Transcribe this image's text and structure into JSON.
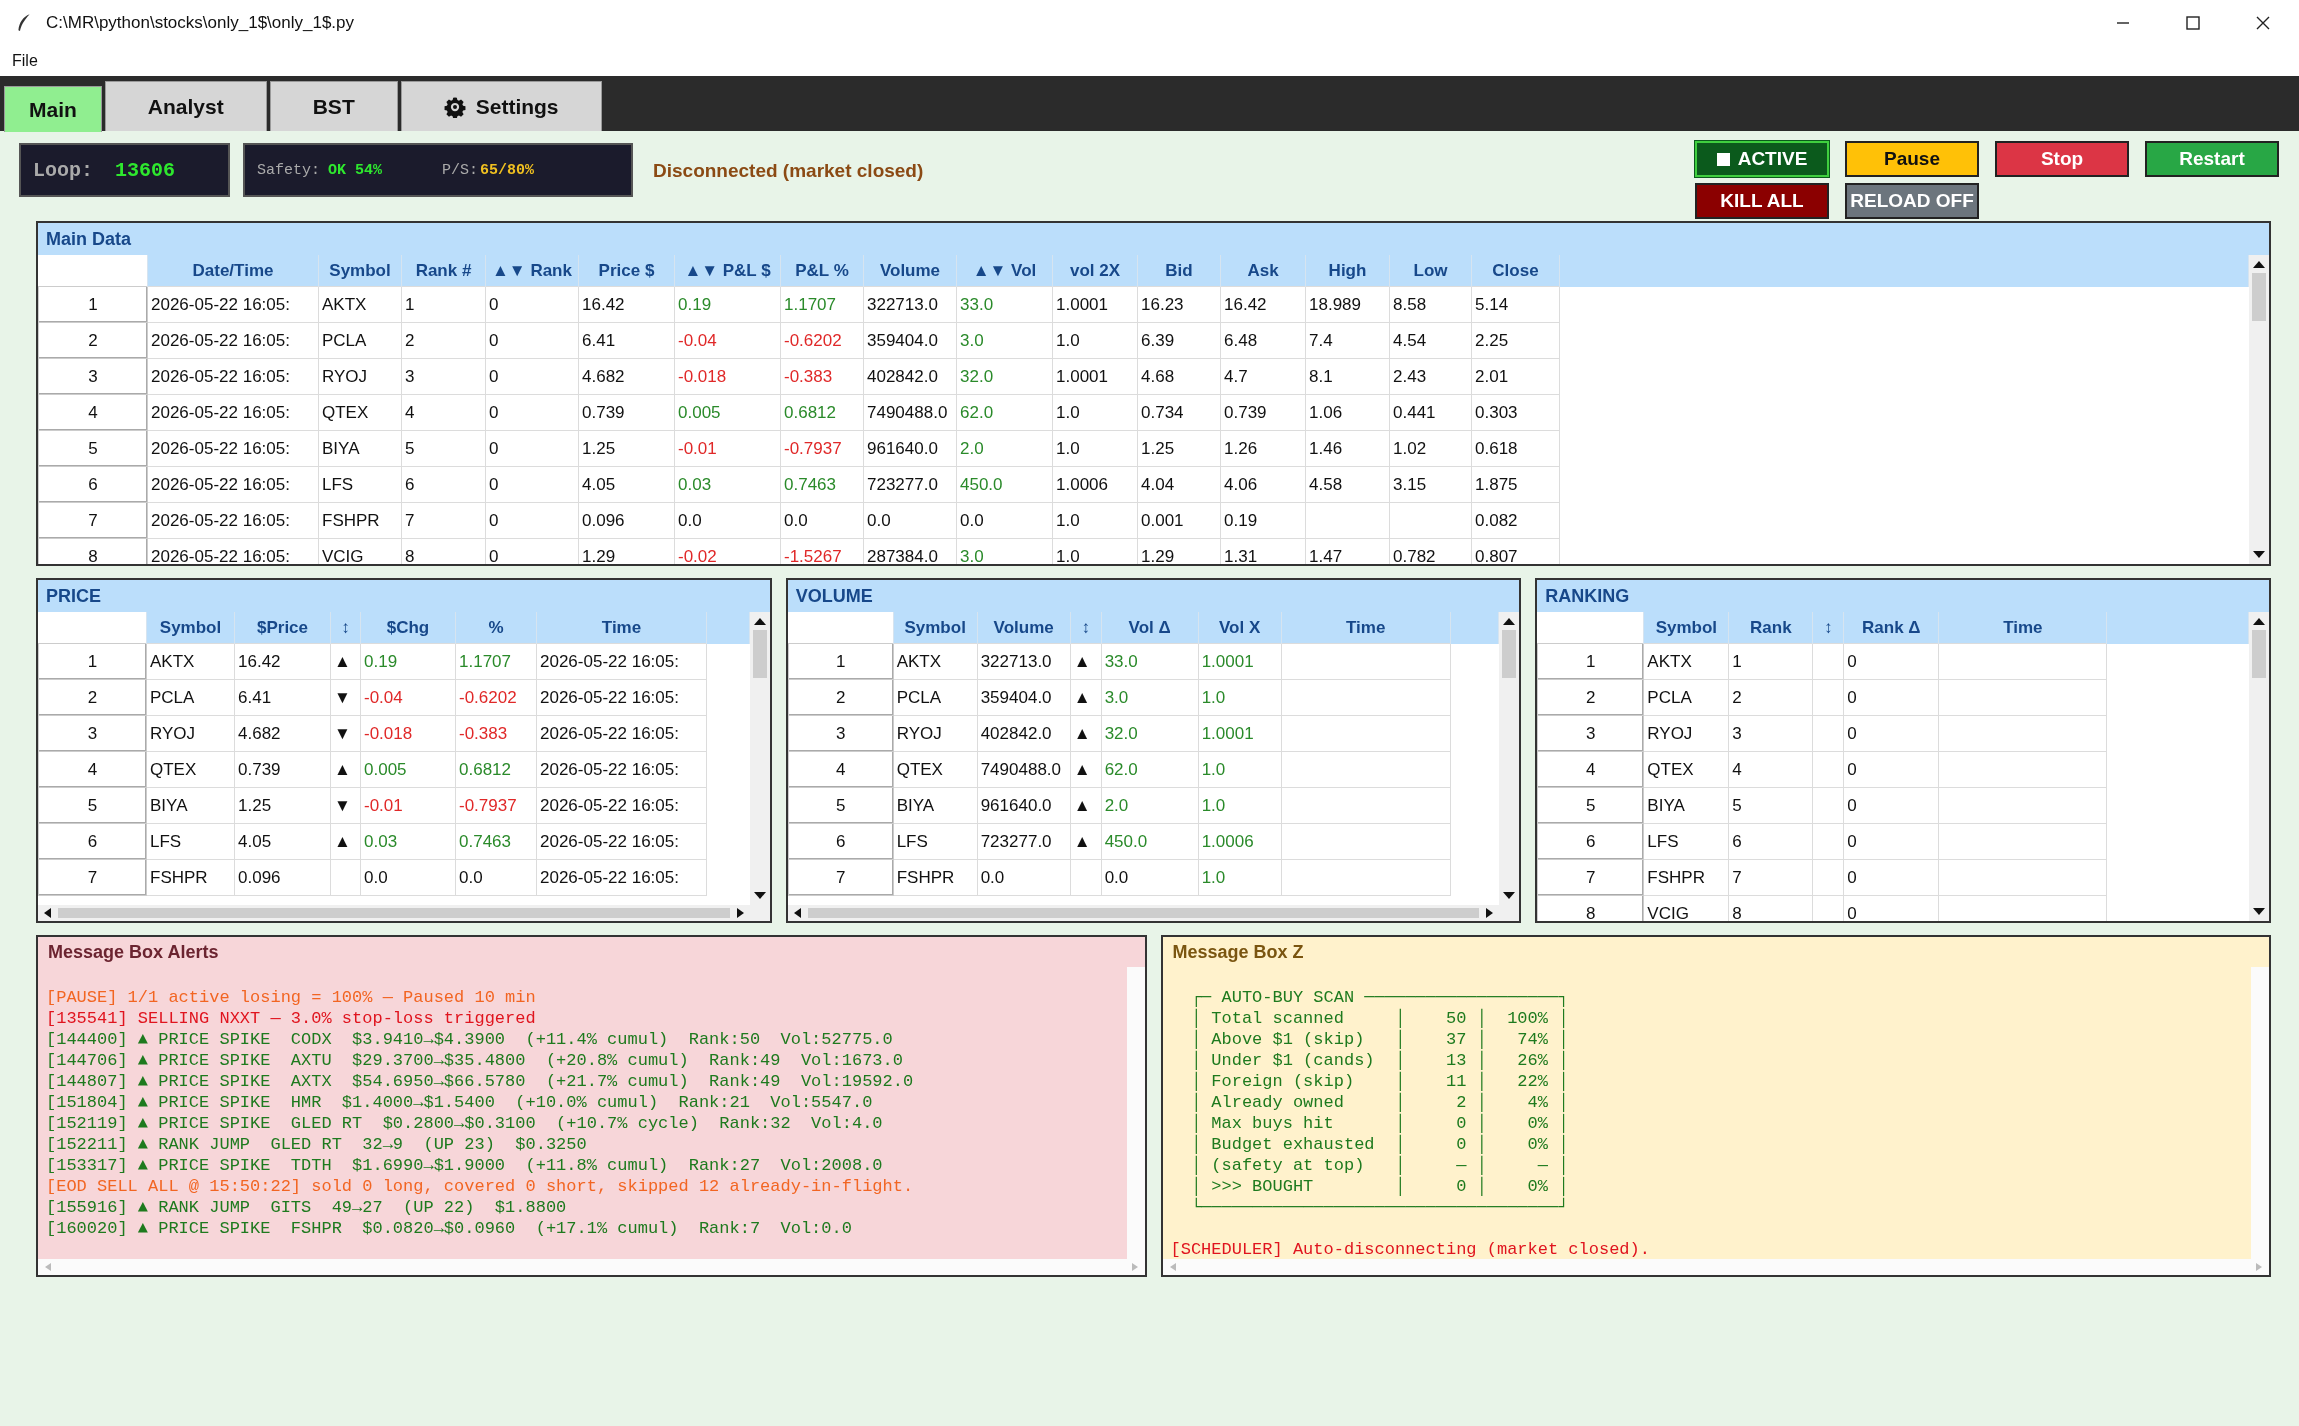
{
  "window": {
    "title": "C:\\MR\\python\\stocks\\only_1$\\only_1$.py"
  },
  "menu": [
    "File"
  ],
  "tabs": [
    {
      "label": "Main",
      "selected": true,
      "kind": "plain"
    },
    {
      "label": "Analyst",
      "selected": false,
      "kind": "plain"
    },
    {
      "label": "BST",
      "selected": false,
      "kind": "plain"
    },
    {
      "label": "Settings",
      "selected": false,
      "kind": "gear"
    }
  ],
  "status": {
    "loop_label": "Loop:",
    "loop_value": "13606",
    "safety_label": "Safety:",
    "safety_value": "OK 54%",
    "ps_label": "P/S:",
    "ps_value": "65/80%",
    "connection": "Disconnected (market closed)"
  },
  "control_rows": [
    {
      "buttons": [
        {
          "label": "ACTIVE",
          "kind": "active"
        },
        {
          "label": "Pause",
          "kind": "pause"
        },
        {
          "label": "Stop",
          "kind": "stop"
        },
        {
          "label": "Restart",
          "kind": "restart"
        }
      ]
    },
    {
      "buttons": [
        {
          "label": "KILL ALL",
          "kind": "kill"
        },
        {
          "label": "RELOAD OFF",
          "kind": "reload"
        }
      ]
    }
  ],
  "main_data": {
    "title": "Main Data",
    "columns": [
      "Date/Time",
      "Symbol",
      "Rank #",
      "▲▼ Rank",
      "Price $",
      "▲▼ P&L $",
      "P&L %",
      "Volume",
      "▲▼ Vol",
      "vol 2X",
      "Bid",
      "Ask",
      "High",
      "Low",
      "Close"
    ],
    "rows": [
      {
        "index": "1",
        "cells": [
          "2026-05-22 16:05:",
          "AKTX",
          "1",
          "0",
          "16.42",
          {
            "text": "0.19",
            "color": "#2a8a2a"
          },
          {
            "text": "1.1707",
            "color": "#2a8a2a"
          },
          "322713.0",
          {
            "text": "33.0",
            "color": "#2a8a2a"
          },
          "1.0001",
          "16.23",
          "16.42",
          "18.989",
          "8.58",
          "5.14"
        ]
      },
      {
        "index": "2",
        "cells": [
          "2026-05-22 16:05:",
          "PCLA",
          "2",
          "0",
          "6.41",
          {
            "text": "-0.04",
            "color": "#e02828"
          },
          {
            "text": "-0.6202",
            "color": "#e02828"
          },
          "359404.0",
          {
            "text": "3.0",
            "color": "#2a8a2a"
          },
          "1.0",
          "6.39",
          "6.48",
          "7.4",
          "4.54",
          "2.25"
        ]
      },
      {
        "index": "3",
        "cells": [
          "2026-05-22 16:05:",
          "RYOJ",
          "3",
          "0",
          "4.682",
          {
            "text": "-0.018",
            "color": "#e02828"
          },
          {
            "text": "-0.383",
            "color": "#e02828"
          },
          "402842.0",
          {
            "text": "32.0",
            "color": "#2a8a2a"
          },
          "1.0001",
          "4.68",
          "4.7",
          "8.1",
          "2.43",
          "2.01"
        ]
      },
      {
        "index": "4",
        "cells": [
          "2026-05-22 16:05:",
          "QTEX",
          "4",
          "0",
          "0.739",
          {
            "text": "0.005",
            "color": "#2a8a2a"
          },
          {
            "text": "0.6812",
            "color": "#2a8a2a"
          },
          "7490488.0",
          {
            "text": "62.0",
            "color": "#2a8a2a"
          },
          "1.0",
          "0.734",
          "0.739",
          "1.06",
          "0.441",
          "0.303"
        ]
      },
      {
        "index": "5",
        "cells": [
          "2026-05-22 16:05:",
          "BIYA",
          "5",
          "0",
          "1.25",
          {
            "text": "-0.01",
            "color": "#e02828"
          },
          {
            "text": "-0.7937",
            "color": "#e02828"
          },
          "961640.0",
          {
            "text": "2.0",
            "color": "#2a8a2a"
          },
          "1.0",
          "1.25",
          "1.26",
          "1.46",
          "1.02",
          "0.618"
        ]
      },
      {
        "index": "6",
        "cells": [
          "2026-05-22 16:05:",
          "LFS",
          "6",
          "0",
          "4.05",
          {
            "text": "0.03",
            "color": "#2a8a2a"
          },
          {
            "text": "0.7463",
            "color": "#2a8a2a"
          },
          "723277.0",
          {
            "text": "450.0",
            "color": "#2a8a2a"
          },
          "1.0006",
          "4.04",
          "4.06",
          "4.58",
          "3.15",
          "1.875"
        ]
      },
      {
        "index": "7",
        "cells": [
          "2026-05-22 16:05:",
          "FSHPR",
          "7",
          "0",
          "0.096",
          "0.0",
          "0.0",
          "0.0",
          "0.0",
          "1.0",
          "0.001",
          "0.19",
          null,
          null,
          "0.082"
        ]
      },
      {
        "index": "8",
        "cells": [
          "2026-05-22 16:05:",
          "VCIG",
          "8",
          "0",
          "1.29",
          {
            "text": "-0.02",
            "color": "#e02828"
          },
          {
            "text": "-1.5267",
            "color": "#e02828"
          },
          "287384.0",
          {
            "text": "3.0",
            "color": "#2a8a2a"
          },
          "1.0",
          "1.29",
          "1.31",
          "1.47",
          "0.782",
          "0.807"
        ]
      }
    ]
  },
  "panels": [
    {
      "title": "PRICE",
      "columns": [
        "Symbol",
        "$Price",
        "↕",
        "$Chg",
        "%",
        "Time"
      ],
      "rows": [
        {
          "index": "1",
          "cells": [
            "AKTX",
            "16.42",
            "▲",
            {
              "text": "0.19",
              "color": "#2a8a2a"
            },
            {
              "text": "1.1707",
              "color": "#2a8a2a"
            },
            "2026-05-22 16:05:"
          ]
        },
        {
          "index": "2",
          "cells": [
            "PCLA",
            "6.41",
            "▼",
            {
              "text": "-0.04",
              "color": "#e02828"
            },
            {
              "text": "-0.6202",
              "color": "#e02828"
            },
            "2026-05-22 16:05:"
          ]
        },
        {
          "index": "3",
          "cells": [
            "RYOJ",
            "4.682",
            "▼",
            {
              "text": "-0.018",
              "color": "#e02828"
            },
            {
              "text": "-0.383",
              "color": "#e02828"
            },
            "2026-05-22 16:05:"
          ]
        },
        {
          "index": "4",
          "cells": [
            "QTEX",
            "0.739",
            "▲",
            {
              "text": "0.005",
              "color": "#2a8a2a"
            },
            {
              "text": "0.6812",
              "color": "#2a8a2a"
            },
            "2026-05-22 16:05:"
          ]
        },
        {
          "index": "5",
          "cells": [
            "BIYA",
            "1.25",
            "▼",
            {
              "text": "-0.01",
              "color": "#e02828"
            },
            {
              "text": "-0.7937",
              "color": "#e02828"
            },
            "2026-05-22 16:05:"
          ]
        },
        {
          "index": "6",
          "cells": [
            "LFS",
            "4.05",
            "▲",
            {
              "text": "0.03",
              "color": "#2a8a2a"
            },
            {
              "text": "0.7463",
              "color": "#2a8a2a"
            },
            "2026-05-22 16:05:"
          ]
        },
        {
          "index": "7",
          "cells": [
            "FSHPR",
            "0.096",
            null,
            "0.0",
            "0.0",
            "2026-05-22 16:05:"
          ]
        }
      ]
    },
    {
      "title": "VOLUME",
      "columns": [
        "Symbol",
        "Volume",
        "↕",
        "Vol Δ",
        "Vol X",
        "Time"
      ],
      "rows": [
        {
          "index": "1",
          "cells": [
            "AKTX",
            "322713.0",
            "▲",
            {
              "text": "33.0",
              "color": "#2a8a2a"
            },
            {
              "text": "1.0001",
              "color": "#2a8a2a"
            },
            null
          ]
        },
        {
          "index": "2",
          "cells": [
            "PCLA",
            "359404.0",
            "▲",
            {
              "text": "3.0",
              "color": "#2a8a2a"
            },
            {
              "text": "1.0",
              "color": "#2a8a2a"
            },
            null
          ]
        },
        {
          "index": "3",
          "cells": [
            "RYOJ",
            "402842.0",
            "▲",
            {
              "text": "32.0",
              "color": "#2a8a2a"
            },
            {
              "text": "1.0001",
              "color": "#2a8a2a"
            },
            null
          ]
        },
        {
          "index": "4",
          "cells": [
            "QTEX",
            "7490488.0",
            "▲",
            {
              "text": "62.0",
              "color": "#2a8a2a"
            },
            {
              "text": "1.0",
              "color": "#2a8a2a"
            },
            null
          ]
        },
        {
          "index": "5",
          "cells": [
            "BIYA",
            "961640.0",
            "▲",
            {
              "text": "2.0",
              "color": "#2a8a2a"
            },
            {
              "text": "1.0",
              "color": "#2a8a2a"
            },
            null
          ]
        },
        {
          "index": "6",
          "cells": [
            "LFS",
            "723277.0",
            "▲",
            {
              "text": "450.0",
              "color": "#2a8a2a"
            },
            {
              "text": "1.0006",
              "color": "#2a8a2a"
            },
            null
          ]
        },
        {
          "index": "7",
          "cells": [
            "FSHPR",
            "0.0",
            null,
            "0.0",
            {
              "text": "1.0",
              "color": "#2a8a2a"
            },
            null
          ]
        }
      ]
    },
    {
      "title": "RANKING",
      "columns": [
        "Symbol",
        "Rank",
        "↕",
        "Rank Δ",
        "Time"
      ],
      "rows": [
        {
          "index": "1",
          "cells": [
            "AKTX",
            "1",
            null,
            "0",
            null
          ]
        },
        {
          "index": "2",
          "cells": [
            "PCLA",
            "2",
            null,
            "0",
            null
          ]
        },
        {
          "index": "3",
          "cells": [
            "RYOJ",
            "3",
            null,
            "0",
            null
          ]
        },
        {
          "index": "4",
          "cells": [
            "QTEX",
            "4",
            null,
            "0",
            null
          ]
        },
        {
          "index": "5",
          "cells": [
            "BIYA",
            "5",
            null,
            "0",
            null
          ]
        },
        {
          "index": "6",
          "cells": [
            "LFS",
            "6",
            null,
            "0",
            null
          ]
        },
        {
          "index": "7",
          "cells": [
            "FSHPR",
            "7",
            null,
            "0",
            null
          ]
        },
        {
          "index": "8",
          "cells": [
            "VCIG",
            "8",
            null,
            "0",
            null
          ]
        }
      ]
    }
  ],
  "message_boxes": [
    {
      "title": "Message Box Alerts",
      "kind": "alerts",
      "lines": [
        {
          "text": "[PAUSE] 1/1 active losing = 100% — Paused 10 min",
          "kind": "notice"
        },
        {
          "text": "[135541] SELLING NXXT — 3.0% stop-loss triggered",
          "kind": "error"
        },
        {
          "text": "[144400] ▲ PRICE SPIKE  CODX  $3.9410→$4.3900  (+11.4% cumul)  Rank:50  Vol:52775.0",
          "kind": "info"
        },
        {
          "text": "[144706] ▲ PRICE SPIKE  AXTU  $29.3700→$35.4800  (+20.8% cumul)  Rank:49  Vol:1673.0",
          "kind": "info"
        },
        {
          "text": "[144807] ▲ PRICE SPIKE  AXTX  $54.6950→$66.5780  (+21.7% cumul)  Rank:49  Vol:19592.0",
          "kind": "info"
        },
        {
          "text": "[151804] ▲ PRICE SPIKE  HMR  $1.4000→$1.5400  (+10.0% cumul)  Rank:21  Vol:5547.0",
          "kind": "info"
        },
        {
          "text": "[152119] ▲ PRICE SPIKE  GLED RT  $0.2800→$0.3100  (+10.7% cycle)  Rank:32  Vol:4.0",
          "kind": "info"
        },
        {
          "text": "[152211] ▲ RANK JUMP  GLED RT  32→9  (UP 23)  $0.3250",
          "kind": "info"
        },
        {
          "text": "[153317] ▲ PRICE SPIKE  TDTH  $1.6990→$1.9000  (+11.8% cumul)  Rank:27  Vol:2008.0",
          "kind": "info"
        },
        {
          "text": "[EOD SELL ALL @ 15:50:22] sold 0 long, covered 0 short, skipped 12 already-in-flight.",
          "kind": "notice"
        },
        {
          "text": "[155916] ▲ RANK JUMP  GITS  49→27  (UP 22)  $1.8800",
          "kind": "info"
        },
        {
          "text": "[160020] ▲ PRICE SPIKE  FSHPR  $0.0820→$0.0960  (+17.1% cumul)  Rank:7  Vol:0.0",
          "kind": "info"
        }
      ]
    },
    {
      "title": "Message Box Z",
      "kind": "scan",
      "lines": [
        {
          "text": "  ┌─ AUTO-BUY SCAN ───────────────────┐",
          "kind": "info"
        },
        {
          "text": "  │ Total scanned     │    50 │  100% │",
          "kind": "info"
        },
        {
          "text": "  │ Above $1 (skip)   │    37 │   74% │",
          "kind": "info"
        },
        {
          "text": "  │ Under $1 (cands)  │    13 │   26% │",
          "kind": "info"
        },
        {
          "text": "  │ Foreign (skip)    │    11 │   22% │",
          "kind": "info"
        },
        {
          "text": "  │ Already owned     │     2 │    4% │",
          "kind": "info"
        },
        {
          "text": "  │ Max buys hit      │     0 │    0% │",
          "kind": "info"
        },
        {
          "text": "  │ Budget exhausted  │     0 │    0% │",
          "kind": "info"
        },
        {
          "text": "  │ (safety at top)   │     — │     — │",
          "kind": "info"
        },
        {
          "text": "  │ >>> BOUGHT        │     0 │    0% │",
          "kind": "info"
        },
        {
          "text": "  └───────────────────────────────────┘",
          "kind": "info"
        },
        {
          "text": "[SCHEDULER] Auto-disconnecting (market closed).",
          "kind": "scheduler"
        }
      ]
    }
  ]
}
